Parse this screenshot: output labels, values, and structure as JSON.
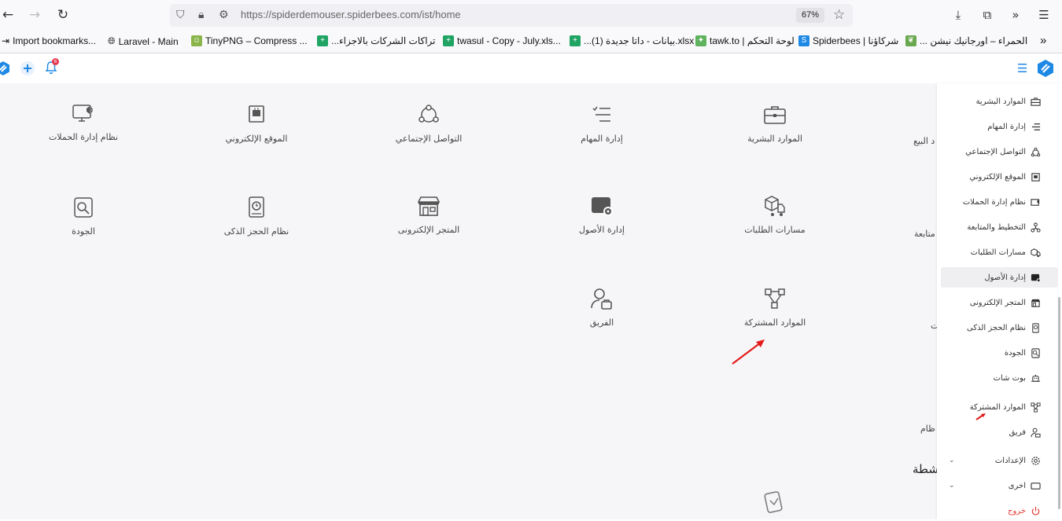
{
  "browser": {
    "url": "https://spiderdemouser.spiderbees.com/ist/home",
    "zoom": "67%"
  },
  "bookmarks": [
    {
      "label": "Import bookmarks...",
      "icon": "import-icon"
    },
    {
      "label": "Laravel - Main",
      "icon": "globe-icon"
    },
    {
      "label": "TinyPNG – Compress ...",
      "icon": "panda-icon"
    },
    {
      "label": "...تراكات الشركات بالاجزاء",
      "icon": "sheets-icon"
    },
    {
      "label": "twasul - Copy - July.xls...",
      "icon": "sheets-icon"
    },
    {
      "label": "...بيانات - داتا جديدة (1).xlsx",
      "icon": "sheets-icon"
    },
    {
      "label": "tawk.to | لوحة التحكم",
      "icon": "tawk-icon"
    },
    {
      "label": "Spiderbees | شركاؤنا",
      "icon": "spiderbees-icon"
    },
    {
      "label": "... الحمراء – اورجانيك نيشن",
      "icon": "leaf-icon"
    }
  ],
  "header": {
    "notification_count": "6"
  },
  "modules": [
    {
      "label": "نظام إدارة الحملات",
      "icon": "campaign-icon"
    },
    {
      "label": "الموقع الإلكتروني",
      "icon": "website-icon"
    },
    {
      "label": "التواصل الإجتماعي",
      "icon": "social-icon"
    },
    {
      "label": "إدارة المهام",
      "icon": "tasks-icon"
    },
    {
      "label": "الموارد البشرية",
      "icon": "briefcase-icon"
    },
    {
      "label": "الجودة",
      "icon": "quality-icon"
    },
    {
      "label": "نظام الحجز الذكى",
      "icon": "booking-icon"
    },
    {
      "label": "المتجر الإلكترونى",
      "icon": "store-icon"
    },
    {
      "label": "إدارة الأصول",
      "icon": "assets-icon"
    },
    {
      "label": "مسارات الطلبات",
      "icon": "orders-icon"
    },
    {
      "label": "الفريق",
      "icon": "team-icon"
    },
    {
      "label": "الموارد المشتركة",
      "icon": "shared-icon"
    }
  ],
  "partials": {
    "sales": "د البيع",
    "followup": "متابعة",
    "t": "ت",
    "system": "ظام",
    "activities": "شطة"
  },
  "sidebar": [
    {
      "label": "الموارد البشرية",
      "icon": "briefcase-icon"
    },
    {
      "label": "إدارة المهام",
      "icon": "tasks-icon"
    },
    {
      "label": "التواصل الإجتماعي",
      "icon": "social-icon"
    },
    {
      "label": "الموقع الإلكتروني",
      "icon": "website-icon"
    },
    {
      "label": "نظام إدارة الحملات",
      "icon": "campaign-icon"
    },
    {
      "label": "التخطيط والمتابعة",
      "icon": "planning-icon"
    },
    {
      "label": "مسارات الطلبات",
      "icon": "orders-icon"
    },
    {
      "label": "إدارة الأصول",
      "icon": "assets-icon"
    },
    {
      "label": "المتجر الإلكترونى",
      "icon": "store-icon"
    },
    {
      "label": "نظام الحجز الذكى",
      "icon": "booking-icon"
    },
    {
      "label": "الجودة",
      "icon": "quality-icon"
    },
    {
      "label": "بوت شات",
      "icon": "bot-icon"
    },
    {
      "label": "الموارد المشتركة",
      "icon": "shared-icon"
    },
    {
      "label": "فريق",
      "icon": "team-icon"
    },
    {
      "label": "الإعدادات",
      "icon": "gear-icon"
    },
    {
      "label": "اخرى",
      "icon": "window-icon"
    },
    {
      "label": "خروج",
      "icon": "power-icon"
    }
  ],
  "colors": {
    "brand": "#1e88e5",
    "logout": "#e53935",
    "arrow": "#e31b1b",
    "badge": "#e53950"
  }
}
